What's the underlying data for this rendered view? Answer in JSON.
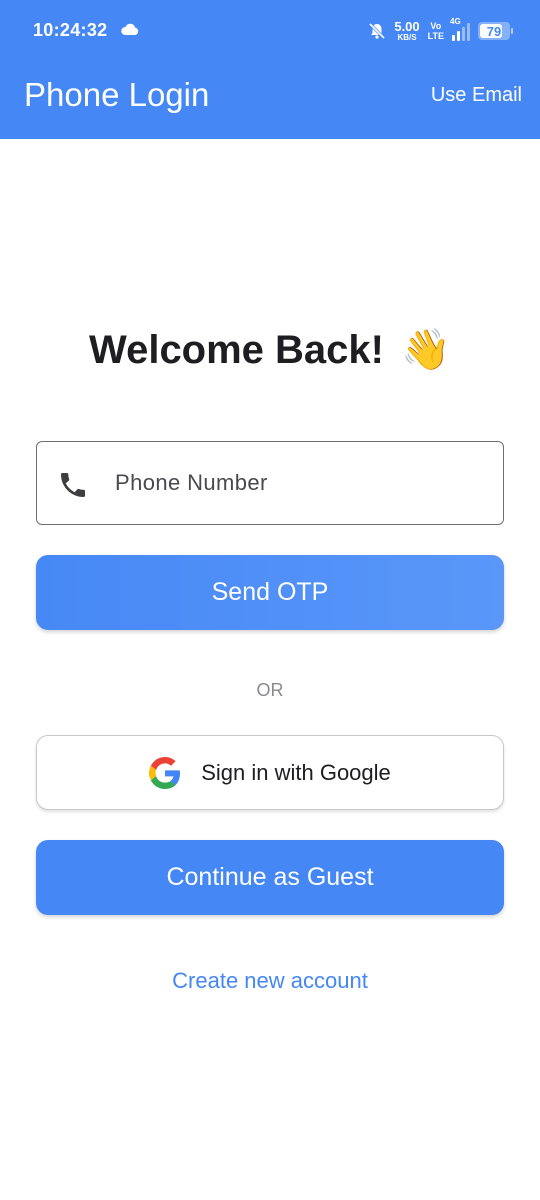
{
  "status_bar": {
    "time": "10:24:32",
    "net_speed_value": "5.00",
    "net_speed_unit": "KB/S",
    "volte_top": "Vo",
    "volte_bottom": "LTE",
    "network_type": "4G",
    "battery_percent": "79"
  },
  "appbar": {
    "title": "Phone Login",
    "action_label": "Use Email"
  },
  "main": {
    "welcome_text": "Welcome Back!",
    "welcome_emoji": "👋",
    "phone_placeholder": "Phone Number",
    "phone_value": "",
    "send_otp_label": "Send OTP",
    "or_label": "OR",
    "google_label": "Sign in with Google",
    "guest_label": "Continue as Guest",
    "create_account_label": "Create new account"
  },
  "colors": {
    "primary": "#4487f5",
    "text_dark": "#1e1e22",
    "muted": "#8a8a8e"
  },
  "icons": [
    "cloud-icon",
    "mute-icon",
    "phone-icon",
    "google-icon",
    "wave-icon"
  ]
}
